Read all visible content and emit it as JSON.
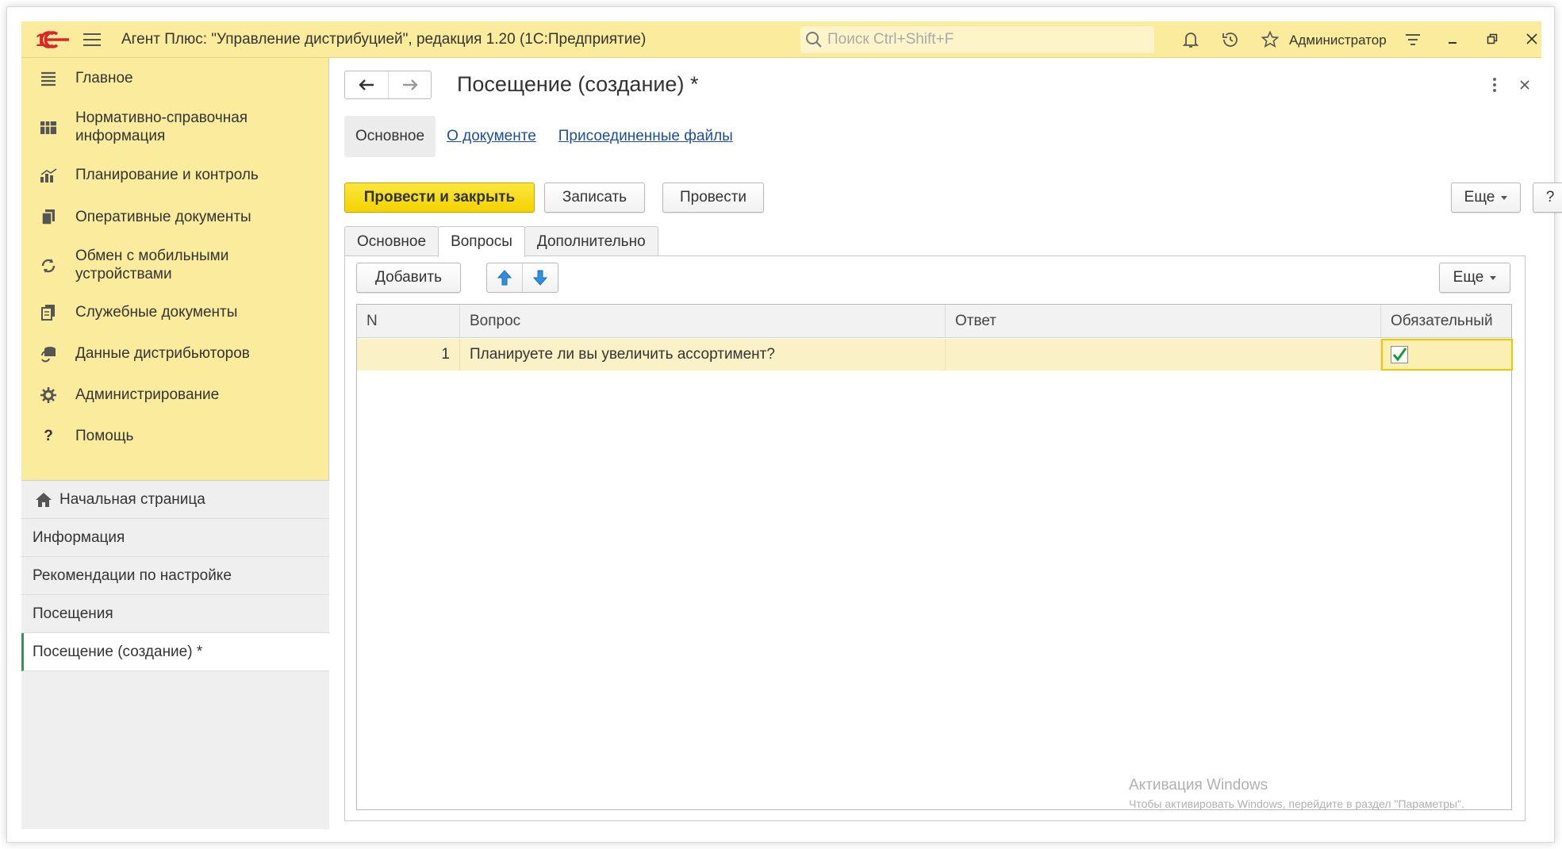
{
  "titlebar": {
    "app_title": "Агент Плюс: \"Управление дистрибуцией\", редакция 1.20  (1С:Предприятие)",
    "search_placeholder": "Поиск Ctrl+Shift+F",
    "user_name": "Администратор",
    "logo_text": "1С"
  },
  "sidebar": {
    "nav_items": [
      {
        "label": "Главное",
        "icon": "hamburger-icon"
      },
      {
        "label": "Нормативно-справочная информация",
        "icon": "catalog-icon"
      },
      {
        "label": "Планирование и контроль",
        "icon": "chart-icon"
      },
      {
        "label": "Оперативные документы",
        "icon": "documents-icon"
      },
      {
        "label": "Обмен с мобильными устройствами",
        "icon": "sync-icon"
      },
      {
        "label": "Служебные документы",
        "icon": "service-docs-icon"
      },
      {
        "label": "Данные дистрибьюторов",
        "icon": "distributors-icon"
      },
      {
        "label": "Администрирование",
        "icon": "gear-icon"
      },
      {
        "label": "Помощь",
        "icon": "help-icon"
      }
    ],
    "open_items": [
      {
        "label": "Начальная страница",
        "icon": "home-icon"
      },
      {
        "label": "Информация"
      },
      {
        "label": "Рекомендации по настройке"
      },
      {
        "label": "Посещения"
      },
      {
        "label": "Посещение (создание) *"
      }
    ]
  },
  "form": {
    "title": "Посещение (создание) *",
    "section_tabs": [
      "Основное",
      "О документе",
      "Присоединенные файлы"
    ],
    "buttons": {
      "post_and_close": "Провести и закрыть",
      "save": "Записать",
      "post": "Провести",
      "more": "Еще",
      "help": "?"
    },
    "page_tabs": [
      "Основное",
      "Вопросы",
      "Дополнительно"
    ],
    "table_toolbar": {
      "add": "Добавить",
      "more": "Еще"
    },
    "table": {
      "columns": [
        "N",
        "Вопрос",
        "Ответ",
        "Обязательный"
      ],
      "rows": [
        {
          "n": "1",
          "question": "Планируете ли вы увеличить ассортимент?",
          "answer": "",
          "required": true
        }
      ]
    }
  },
  "watermark": {
    "line1": "Активация Windows",
    "line2": "Чтобы активировать Windows, перейдите в раздел \"Параметры\"."
  },
  "colors": {
    "titlebar_bg": "#fbec9d",
    "primary_button": "#f3d300",
    "selected_row": "#fbf1c6",
    "link": "#1b4f9c",
    "check": "#1a9a3c"
  }
}
